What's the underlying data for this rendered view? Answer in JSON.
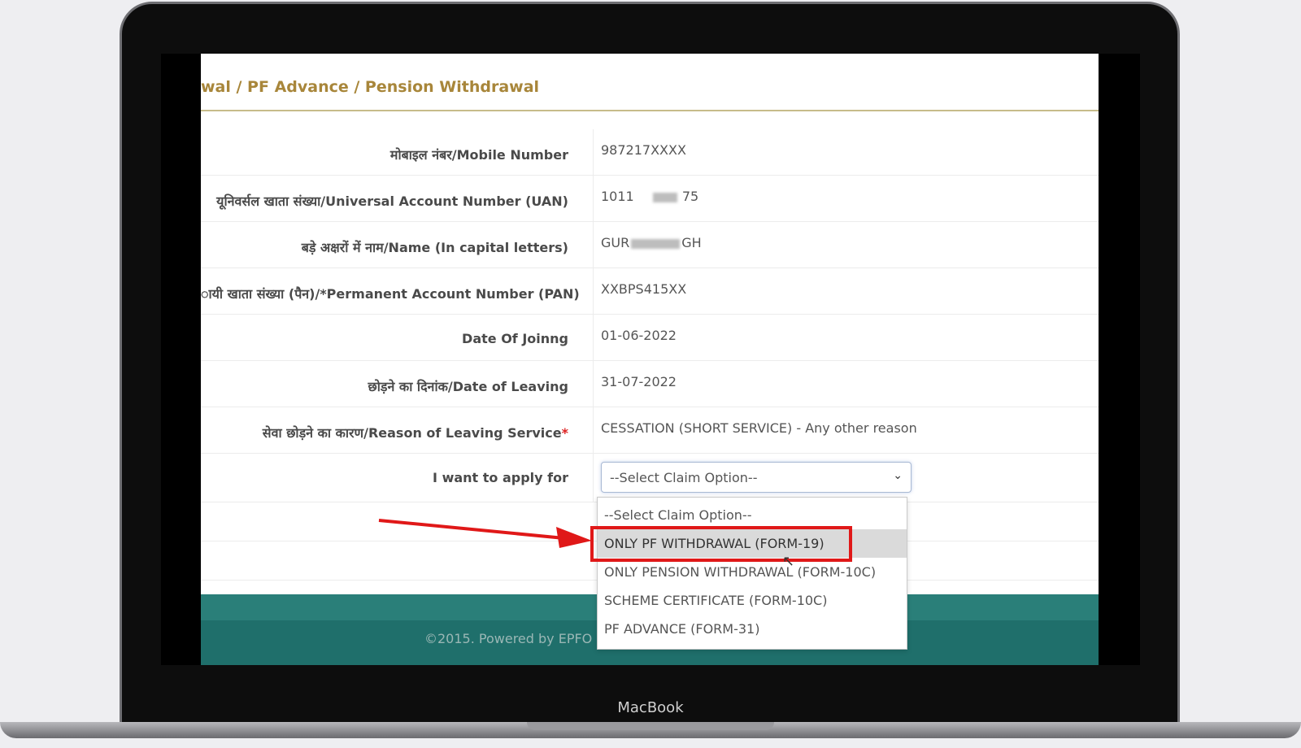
{
  "breadcrumb": "wal / PF Advance / Pension Withdrawal",
  "form": {
    "rows": [
      {
        "label": "मोबाइल नंबर/Mobile Number",
        "value": "987217XXXX"
      },
      {
        "label": "यूनिवर्सल खाता संख्या/Universal Account Number (UAN)",
        "value_prefix": "1011",
        "value_suffix": "75"
      },
      {
        "label": "बड़े अक्षरों में नाम/Name (In capital letters)",
        "value_prefix": "GUR",
        "value_suffix": "GH"
      },
      {
        "label": "ायी खाता संख्या (पैन)/*Permanent Account Number (PAN)",
        "value": "XXBPS415XX"
      },
      {
        "label": "Date Of Joinng",
        "value": "01-06-2022"
      },
      {
        "label": "छोड़ने का दिनांक/Date of Leaving",
        "value": "31-07-2022"
      },
      {
        "label": "सेवा छोड़ने का कारण/Reason of Leaving Service",
        "required_mark": "*",
        "value": "CESSATION (SHORT SERVICE) - Any other reason"
      }
    ],
    "apply_for": {
      "label": "I want to apply for",
      "selected": "--Select Claim Option--",
      "chevron_icon": "chevron-down-icon"
    }
  },
  "dropdown": {
    "options": [
      "--Select Claim Option--",
      "ONLY PF WITHDRAWAL (FORM-19)",
      "ONLY PENSION WITHDRAWAL (FORM-10C)",
      "SCHEME CERTIFICATE (FORM-10C)",
      "PF ADVANCE (FORM-31)"
    ],
    "highlighted_index": 1
  },
  "footer": {
    "text": "©2015. Powered by EPFO We"
  },
  "device": {
    "brand": "MacBook"
  },
  "colors": {
    "breadcrumb": "#a8863a",
    "footer": "#1f6f6b",
    "highlight": "#e01818",
    "arrow": "#e01818"
  }
}
